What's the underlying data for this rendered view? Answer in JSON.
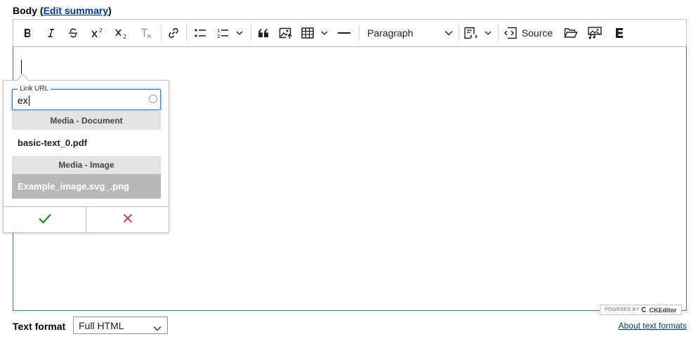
{
  "field": {
    "label": "Body",
    "summary_link": "Edit summary"
  },
  "toolbar": {
    "items": [
      {
        "name": "bold",
        "icon": "bold-icon"
      },
      {
        "name": "italic",
        "icon": "italic-icon"
      },
      {
        "name": "strikethrough",
        "icon": "strikethrough-icon"
      },
      {
        "name": "superscript",
        "icon": "superscript-icon"
      },
      {
        "name": "subscript",
        "icon": "subscript-icon"
      },
      {
        "name": "remove-format",
        "icon": "remove-format-icon",
        "disabled": true
      },
      {
        "name": "link",
        "icon": "link-icon"
      },
      {
        "name": "bulleted-list",
        "icon": "bulleted-list-icon"
      },
      {
        "name": "numbered-list",
        "icon": "numbered-list-icon"
      },
      {
        "name": "block-quote",
        "icon": "block-quote-icon"
      },
      {
        "name": "insert-image",
        "icon": "insert-image-icon"
      },
      {
        "name": "insert-table",
        "icon": "table-icon"
      },
      {
        "name": "horizontal-line",
        "icon": "horizontal-line-icon"
      },
      {
        "name": "code-block",
        "icon": "code-block-icon"
      },
      {
        "name": "media-library",
        "icon": "folder-open-icon"
      },
      {
        "name": "drupal-media",
        "icon": "media-icon"
      },
      {
        "name": "entity-embed",
        "icon": "entity-embed-icon"
      }
    ],
    "heading_dropdown": "Paragraph",
    "source_label": "Source"
  },
  "link_balloon": {
    "legend": "Link URL",
    "value": "ex",
    "groups": [
      {
        "title": "Media - Document",
        "items": [
          {
            "label": "basic-text_0.pdf",
            "active": false
          }
        ]
      },
      {
        "title": "Media - Image",
        "items": [
          {
            "label": "Example_image.svg_.png",
            "active": true
          }
        ]
      }
    ],
    "save_icon": "checkmark-icon",
    "cancel_icon": "close-icon",
    "save_color": "#008a21",
    "cancel_color": "#d32f1b"
  },
  "powered_by": {
    "prefix": "POWERED BY",
    "brand": "CKEditor"
  },
  "text_format": {
    "label": "Text format",
    "selected": "Full HTML",
    "help_link": "About text formats"
  },
  "colors": {
    "focus": "#2977ff",
    "link": "#0036b1",
    "active_item": "#b8b8b8",
    "group_header": "#e3e3e3"
  }
}
